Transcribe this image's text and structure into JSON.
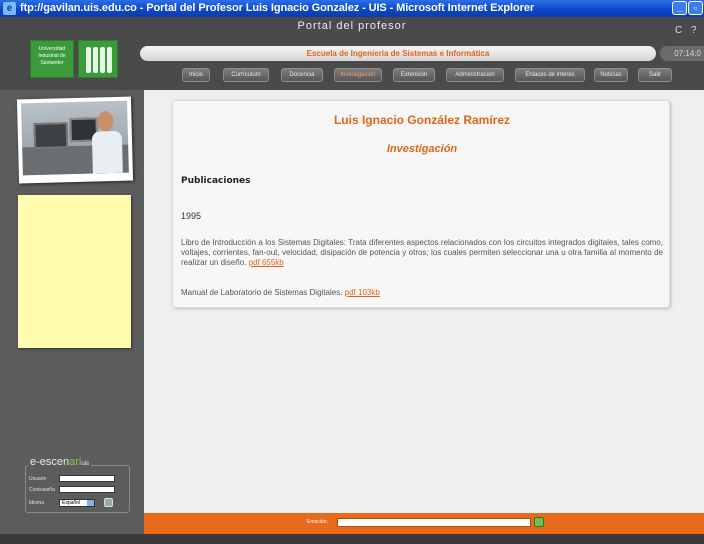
{
  "browser": {
    "window_title": "ftp://gavilan.uis.edu.co - Portal del Profesor Luis Ignacio Gonzalez - UIS - Microsoft Internet Explorer"
  },
  "header": {
    "portal_title": "Portal del profesor",
    "logo_text": "Universidad Industrial de Santander",
    "school_name": "Escuela de Ingeniería de Sistemas e Informática",
    "clock": "07:14:0",
    "help_icons": "C ?"
  },
  "nav": {
    "items": [
      "Inicio",
      "Currículum",
      "Docencia",
      "Investigación",
      "Extensión",
      "Administración",
      "Enlaces de interés",
      "Noticias",
      "Salir"
    ],
    "active": "Investigación"
  },
  "sidebar": {
    "brand_main": "e-escen",
    "brand_accent": "ari",
    "brand_suffix": "uis",
    "login": {
      "user_label": "Usuario",
      "password_label": "Contraseña",
      "language_label": "Idioma",
      "language_value": "Español"
    }
  },
  "content": {
    "professor_name": "Luis Ignacio González Ramírez",
    "section": "Investigación",
    "publications_heading": "Publicaciones",
    "year": "1995",
    "pub1_text": "Libro de Introducción a los Sistemas Digitales:  Trata diferentes aspectos relacionados con los circuitos integrados digitales, tales como, voltajes, corrientes, fan-out, velocidad, disipación de potencia y otros; los cuales permiten seleccionar una u otra familia al momento de realizar un diseño.",
    "pub1_link": "pdf 655kb",
    "pub2_text": "Manual de Laboratorio de Sistemas Digitales.",
    "pub2_link": "pdf 103kb"
  },
  "footer": {
    "label": "Emoción:"
  },
  "colors": {
    "accent": "#e0651c",
    "dark": "#4a4a4a",
    "footer": "#e96a1a"
  }
}
